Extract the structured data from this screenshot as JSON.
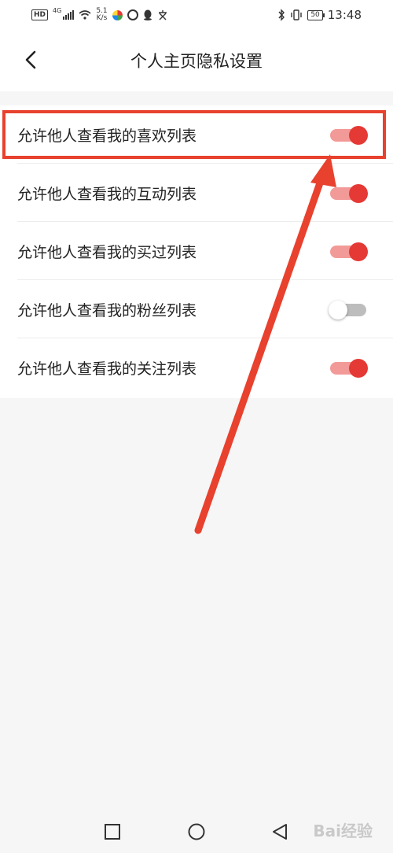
{
  "status_bar": {
    "hd": "HD",
    "network": "4G",
    "speed_value": "5.1",
    "speed_unit": "K/s",
    "battery": "50",
    "time": "13:48"
  },
  "header": {
    "title": "个人主页隐私设置",
    "back_icon": "chevron-left-icon"
  },
  "settings": [
    {
      "label": "允许他人查看我的喜欢列表",
      "enabled": true
    },
    {
      "label": "允许他人查看我的互动列表",
      "enabled": true
    },
    {
      "label": "允许他人查看我的买过列表",
      "enabled": true
    },
    {
      "label": "允许他人查看我的粉丝列表",
      "enabled": false
    },
    {
      "label": "允许他人查看我的关注列表",
      "enabled": true
    }
  ],
  "colors": {
    "accent": "#e53935",
    "track_on": "#f29a98",
    "track_off": "#bdbdbd",
    "annotation": "#e8412e"
  },
  "navbar": {
    "icons": [
      "square-recents-icon",
      "circle-home-icon",
      "triangle-back-icon"
    ]
  },
  "watermark": "Bai经验"
}
